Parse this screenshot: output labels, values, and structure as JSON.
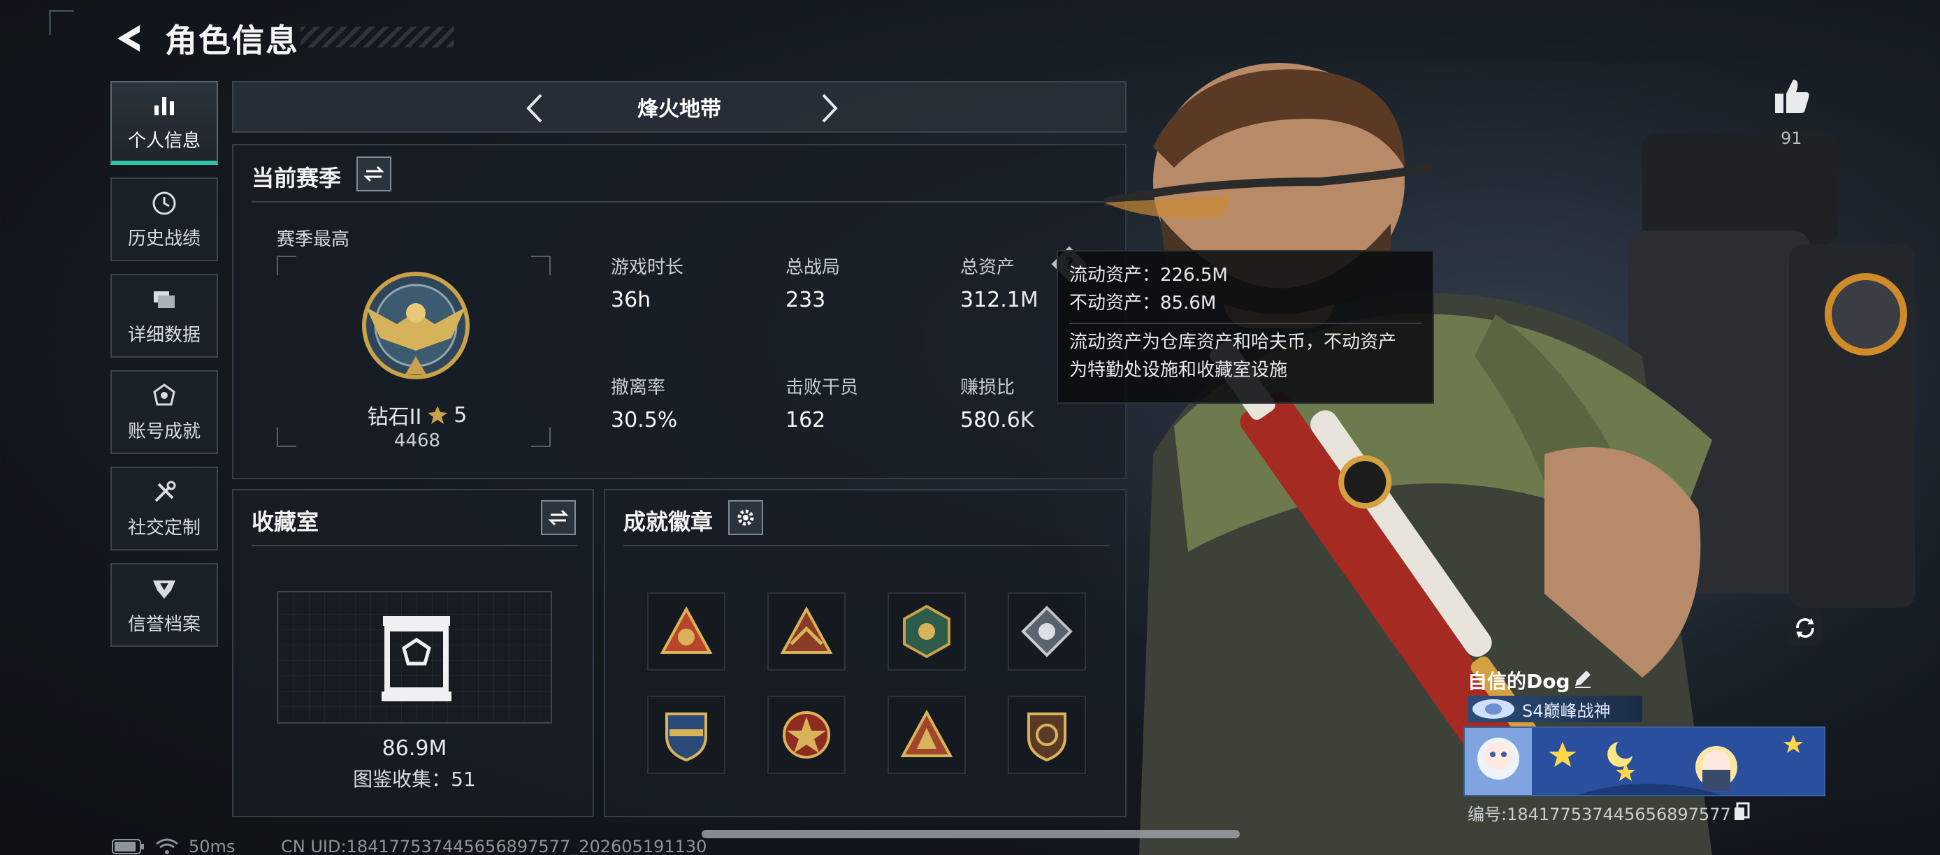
{
  "header": {
    "title": "角色信息"
  },
  "sidebar": {
    "items": [
      {
        "label": "个人信息",
        "icon": "bar-chart-icon",
        "active": true
      },
      {
        "label": "历史战绩",
        "icon": "clock-icon"
      },
      {
        "label": "详细数据",
        "icon": "folder-icon"
      },
      {
        "label": "账号成就",
        "icon": "achievement-icon"
      },
      {
        "label": "社交定制",
        "icon": "tools-icon"
      },
      {
        "label": "信誉档案",
        "icon": "credit-shield-icon"
      }
    ]
  },
  "season_selector": {
    "name": "烽火地带"
  },
  "current_season": {
    "title": "当前赛季",
    "best_label": "赛季最高",
    "rank_name": "钻石II",
    "rank_stars": "5",
    "rank_score": "4468",
    "stats": [
      {
        "label": "游戏时长",
        "value": "36h"
      },
      {
        "label": "总战局",
        "value": "233"
      },
      {
        "label": "总资产",
        "value": "312.1M"
      },
      {
        "label": "撤离率",
        "value": "30.5%"
      },
      {
        "label": "击败干员",
        "value": "162"
      },
      {
        "label": "赚损比",
        "value": "580.6K"
      }
    ]
  },
  "tooltip": {
    "liquid": "流动资产：226.5M",
    "fixed": "不动资产：85.6M",
    "desc_line1": "流动资产为仓库资产和哈夫币，不动资产",
    "desc_line2": "为特勤处设施和收藏室设施"
  },
  "collection": {
    "title": "收藏室",
    "value": "86.9M",
    "catalog": "图鉴收集：51"
  },
  "badges": {
    "title": "成就徽章",
    "count_visible": 8
  },
  "profile": {
    "likes": "91",
    "player_name": "自信的Dog",
    "rank_title": "S4巅峰战神",
    "player_id": "编号:184177537445656897577"
  },
  "footer": {
    "ping": "50ms",
    "uid": "CN UID:184177537445656897577_202605191130"
  },
  "colors": {
    "accent": "#2ec4a8",
    "panel_border": "#353f49",
    "gold": "#c9a24a"
  }
}
